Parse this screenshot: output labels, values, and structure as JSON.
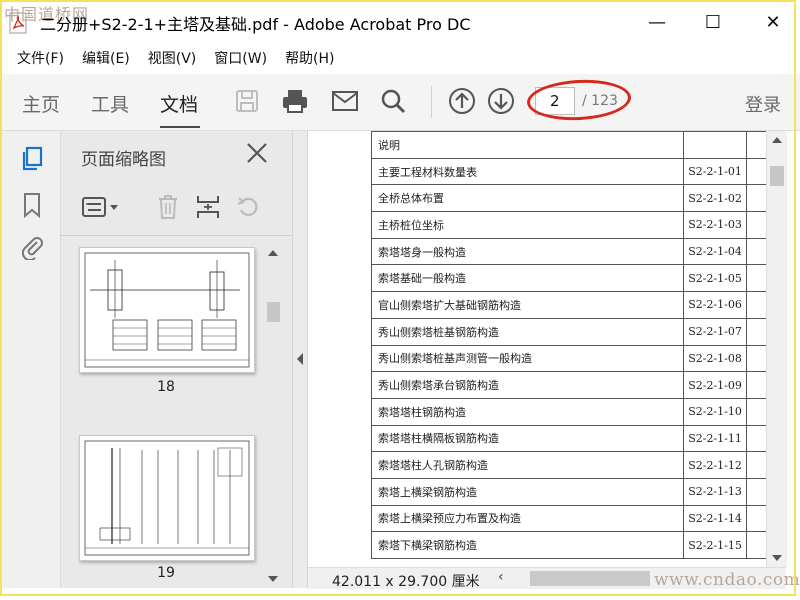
{
  "window": {
    "watermark_top": "中国道桥网",
    "title": "二分册+S2-2-1+主塔及基础.pdf - Adobe Acrobat Pro DC",
    "controls": {
      "minimize": "—",
      "maximize": "☐",
      "close": "✕"
    }
  },
  "menu": [
    "文件(F)",
    "编辑(E)",
    "视图(V)",
    "窗口(W)",
    "帮助(H)"
  ],
  "toolbar": {
    "tabs": [
      "主页",
      "工具",
      "文档"
    ],
    "active_tab": "文档",
    "current_page": "2",
    "total_pages": "/ 123",
    "login": "登录"
  },
  "thumb_panel": {
    "title": "页面缩略图",
    "pages": [
      "18",
      "19"
    ]
  },
  "document": {
    "rows": [
      {
        "name": "说明",
        "code": ""
      },
      {
        "name": "主要工程材料数量表",
        "code": "S2-2-1-01"
      },
      {
        "name": "全桥总体布置",
        "code": "S2-2-1-02"
      },
      {
        "name": "主桥桩位坐标",
        "code": "S2-2-1-03"
      },
      {
        "name": "索塔塔身一般构造",
        "code": "S2-2-1-04"
      },
      {
        "name": "索塔基础一般构造",
        "code": "S2-2-1-05"
      },
      {
        "name": "官山侧索塔扩大基础钢筋构造",
        "code": "S2-2-1-06"
      },
      {
        "name": "秀山侧索塔桩基钢筋构造",
        "code": "S2-2-1-07"
      },
      {
        "name": "秀山侧索塔桩基声测管一般构造",
        "code": "S2-2-1-08"
      },
      {
        "name": "秀山侧索塔承台钢筋构造",
        "code": "S2-2-1-09"
      },
      {
        "name": "索塔塔柱钢筋构造",
        "code": "S2-2-1-10"
      },
      {
        "name": "索塔塔柱横隔板钢筋构造",
        "code": "S2-2-1-11"
      },
      {
        "name": "索塔塔柱人孔钢筋构造",
        "code": "S2-2-1-12"
      },
      {
        "name": "索塔上横梁钢筋构造",
        "code": "S2-2-1-13"
      },
      {
        "name": "索塔上横梁预应力布置及构造",
        "code": "S2-2-1-14"
      },
      {
        "name": "索塔下横梁钢筋构造",
        "code": "S2-2-1-15"
      }
    ]
  },
  "status": {
    "page_size": "42.011 x 29.700 厘米",
    "watermark_bottom": "www.cndao.com"
  },
  "colors": {
    "highlight_ellipse": "#d42a1b",
    "acrobat_red": "#d6251c",
    "active_rail_icon": "#1a73c9",
    "frame_border": "#f2e35a"
  }
}
